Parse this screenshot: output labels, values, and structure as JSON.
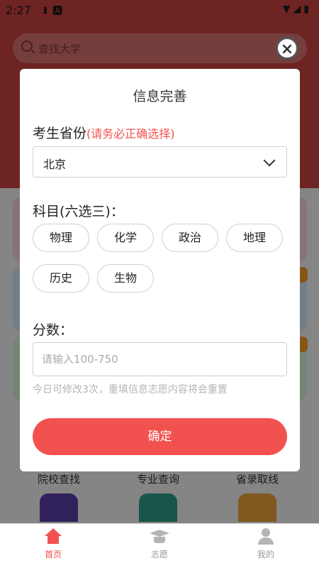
{
  "status_bar": {
    "time": "2:27",
    "left_icons": "⬇ 🅰",
    "right_icons": "▼◢▮"
  },
  "search": {
    "placeholder": "查找大学"
  },
  "quick_links": [
    {
      "label": "院校查找",
      "color": "#5b3fa8"
    },
    {
      "label": "专业查询",
      "color": "#2a9d83"
    },
    {
      "label": "省录取线",
      "color": "#e8a33b"
    }
  ],
  "modal": {
    "title": "信息完善",
    "province_label": "考生省份",
    "province_hint": "(请务必正确选择)",
    "province_value": "北京",
    "subject_label": "科目(六选三)：",
    "subjects": [
      "物理",
      "化学",
      "政治",
      "地理",
      "历史",
      "生物"
    ],
    "score_label": "分数：",
    "score_placeholder": "请输入100-750",
    "note": "今日可修改3次，重填信息志愿内容将会重置",
    "confirm": "确定"
  },
  "tabs": [
    {
      "label": "首页",
      "icon": "home-icon",
      "active": true
    },
    {
      "label": "志愿",
      "icon": "graduation-cap-icon",
      "active": false
    },
    {
      "label": "我的",
      "icon": "user-icon",
      "active": false
    }
  ],
  "colors": {
    "accent": "#f2524f",
    "header": "#c8423f"
  }
}
